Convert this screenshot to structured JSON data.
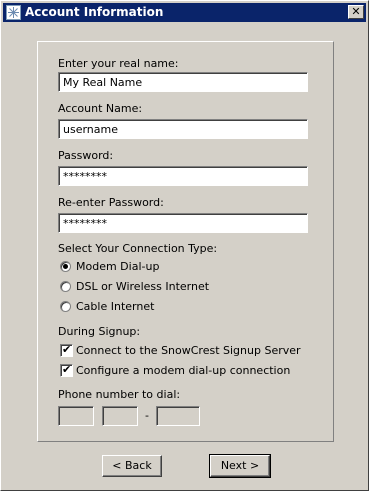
{
  "window": {
    "title": "Account Information",
    "close_label": "✕"
  },
  "form": {
    "real_name_label": "Enter your real name:",
    "real_name_value": "My Real Name",
    "account_name_label": "Account Name:",
    "account_name_value": "username",
    "password_label": "Password:",
    "password_value": "********",
    "reenter_password_label": "Re-enter Password:",
    "reenter_password_value": "********",
    "connection_type_label": "Select Your Connection Type:",
    "connection_options": [
      {
        "label": "Modem Dial-up",
        "selected": true
      },
      {
        "label": "DSL or Wireless Internet",
        "selected": false
      },
      {
        "label": "Cable Internet",
        "selected": false
      }
    ],
    "during_signup_label": "During Signup:",
    "signup_options": [
      {
        "label": "Connect to the SnowCrest Signup Server",
        "checked": true
      },
      {
        "label": "Configure a modem dial-up connection",
        "checked": true
      }
    ],
    "phone_label": "Phone number to dial:",
    "phone_separator": "-"
  },
  "buttons": {
    "back_label": "< Back",
    "next_label": "Next >"
  },
  "icons": {
    "app": "snowflake-icon",
    "check": "checkmark-icon"
  }
}
